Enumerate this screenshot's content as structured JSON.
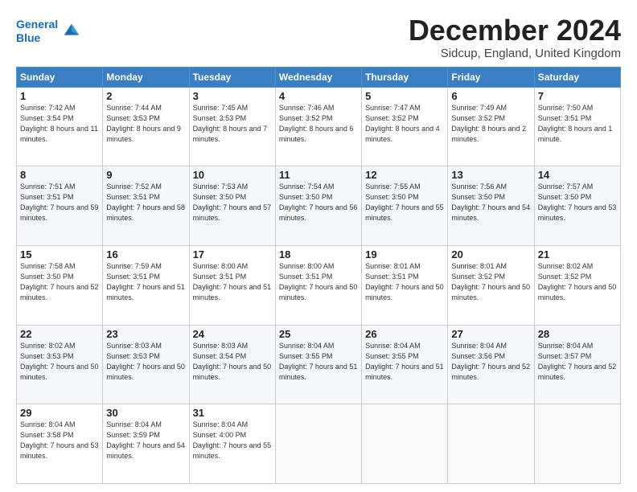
{
  "header": {
    "logo_line1": "General",
    "logo_line2": "Blue",
    "month_title": "December 2024",
    "location": "Sidcup, England, United Kingdom"
  },
  "weekdays": [
    "Sunday",
    "Monday",
    "Tuesday",
    "Wednesday",
    "Thursday",
    "Friday",
    "Saturday"
  ],
  "weeks": [
    [
      {
        "day": "1",
        "sunrise": "7:42 AM",
        "sunset": "3:54 PM",
        "daylight": "8 hours and 11 minutes."
      },
      {
        "day": "2",
        "sunrise": "7:44 AM",
        "sunset": "3:53 PM",
        "daylight": "8 hours and 9 minutes."
      },
      {
        "day": "3",
        "sunrise": "7:45 AM",
        "sunset": "3:53 PM",
        "daylight": "8 hours and 7 minutes."
      },
      {
        "day": "4",
        "sunrise": "7:46 AM",
        "sunset": "3:52 PM",
        "daylight": "8 hours and 6 minutes."
      },
      {
        "day": "5",
        "sunrise": "7:47 AM",
        "sunset": "3:52 PM",
        "daylight": "8 hours and 4 minutes."
      },
      {
        "day": "6",
        "sunrise": "7:49 AM",
        "sunset": "3:52 PM",
        "daylight": "8 hours and 2 minutes."
      },
      {
        "day": "7",
        "sunrise": "7:50 AM",
        "sunset": "3:51 PM",
        "daylight": "8 hours and 1 minute."
      }
    ],
    [
      {
        "day": "8",
        "sunrise": "7:51 AM",
        "sunset": "3:51 PM",
        "daylight": "7 hours and 59 minutes."
      },
      {
        "day": "9",
        "sunrise": "7:52 AM",
        "sunset": "3:51 PM",
        "daylight": "7 hours and 58 minutes."
      },
      {
        "day": "10",
        "sunrise": "7:53 AM",
        "sunset": "3:50 PM",
        "daylight": "7 hours and 57 minutes."
      },
      {
        "day": "11",
        "sunrise": "7:54 AM",
        "sunset": "3:50 PM",
        "daylight": "7 hours and 56 minutes."
      },
      {
        "day": "12",
        "sunrise": "7:55 AM",
        "sunset": "3:50 PM",
        "daylight": "7 hours and 55 minutes."
      },
      {
        "day": "13",
        "sunrise": "7:56 AM",
        "sunset": "3:50 PM",
        "daylight": "7 hours and 54 minutes."
      },
      {
        "day": "14",
        "sunrise": "7:57 AM",
        "sunset": "3:50 PM",
        "daylight": "7 hours and 53 minutes."
      }
    ],
    [
      {
        "day": "15",
        "sunrise": "7:58 AM",
        "sunset": "3:50 PM",
        "daylight": "7 hours and 52 minutes."
      },
      {
        "day": "16",
        "sunrise": "7:59 AM",
        "sunset": "3:51 PM",
        "daylight": "7 hours and 51 minutes."
      },
      {
        "day": "17",
        "sunrise": "8:00 AM",
        "sunset": "3:51 PM",
        "daylight": "7 hours and 51 minutes."
      },
      {
        "day": "18",
        "sunrise": "8:00 AM",
        "sunset": "3:51 PM",
        "daylight": "7 hours and 50 minutes."
      },
      {
        "day": "19",
        "sunrise": "8:01 AM",
        "sunset": "3:51 PM",
        "daylight": "7 hours and 50 minutes."
      },
      {
        "day": "20",
        "sunrise": "8:01 AM",
        "sunset": "3:52 PM",
        "daylight": "7 hours and 50 minutes."
      },
      {
        "day": "21",
        "sunrise": "8:02 AM",
        "sunset": "3:52 PM",
        "daylight": "7 hours and 50 minutes."
      }
    ],
    [
      {
        "day": "22",
        "sunrise": "8:02 AM",
        "sunset": "3:53 PM",
        "daylight": "7 hours and 50 minutes."
      },
      {
        "day": "23",
        "sunrise": "8:03 AM",
        "sunset": "3:53 PM",
        "daylight": "7 hours and 50 minutes."
      },
      {
        "day": "24",
        "sunrise": "8:03 AM",
        "sunset": "3:54 PM",
        "daylight": "7 hours and 50 minutes."
      },
      {
        "day": "25",
        "sunrise": "8:04 AM",
        "sunset": "3:55 PM",
        "daylight": "7 hours and 51 minutes."
      },
      {
        "day": "26",
        "sunrise": "8:04 AM",
        "sunset": "3:55 PM",
        "daylight": "7 hours and 51 minutes."
      },
      {
        "day": "27",
        "sunrise": "8:04 AM",
        "sunset": "3:56 PM",
        "daylight": "7 hours and 52 minutes."
      },
      {
        "day": "28",
        "sunrise": "8:04 AM",
        "sunset": "3:57 PM",
        "daylight": "7 hours and 52 minutes."
      }
    ],
    [
      {
        "day": "29",
        "sunrise": "8:04 AM",
        "sunset": "3:58 PM",
        "daylight": "7 hours and 53 minutes."
      },
      {
        "day": "30",
        "sunrise": "8:04 AM",
        "sunset": "3:59 PM",
        "daylight": "7 hours and 54 minutes."
      },
      {
        "day": "31",
        "sunrise": "8:04 AM",
        "sunset": "4:00 PM",
        "daylight": "7 hours and 55 minutes."
      },
      null,
      null,
      null,
      null
    ]
  ]
}
